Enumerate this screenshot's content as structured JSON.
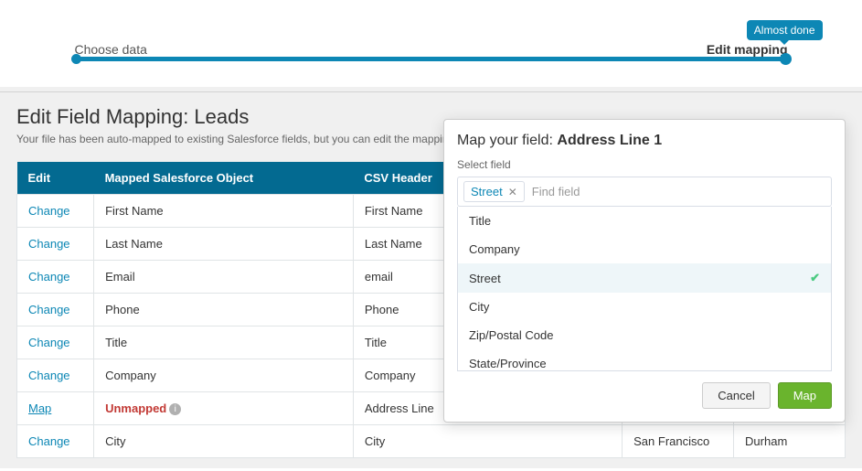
{
  "progress": {
    "badge": "Almost done",
    "step1": "Choose data",
    "step2": "Edit mapping"
  },
  "page": {
    "title": "Edit Field Mapping: Leads",
    "subtitle": "Your file has been auto-mapped to existing Salesforce fields, but you can edit the mappings if you"
  },
  "table": {
    "headers": {
      "edit": "Edit",
      "mapped": "Mapped Salesforce Object",
      "csv": "CSV Header",
      "sample1": "",
      "sample2": ""
    },
    "rows": [
      {
        "edit": "Change",
        "mapped": "First Name",
        "csv": "First Name",
        "s1": "",
        "s2": ""
      },
      {
        "edit": "Change",
        "mapped": "Last Name",
        "csv": "Last Name",
        "s1": "",
        "s2": ""
      },
      {
        "edit": "Change",
        "mapped": "Email",
        "csv": "email",
        "s1": "",
        "s2": ""
      },
      {
        "edit": "Change",
        "mapped": "Phone",
        "csv": "Phone",
        "s1": "",
        "s2": ""
      },
      {
        "edit": "Change",
        "mapped": "Title",
        "csv": "Title",
        "s1": "",
        "s2": ""
      },
      {
        "edit": "Change",
        "mapped": "Company",
        "csv": "Company",
        "s1": "",
        "s2": ""
      },
      {
        "edit": "Map",
        "mapped": "Unmapped",
        "csv": "Address Line",
        "unmapped": true,
        "s1": "",
        "s2": ""
      },
      {
        "edit": "Change",
        "mapped": "City",
        "csv": "City",
        "s1": "San Francisco",
        "s2": "Durham"
      }
    ]
  },
  "modal": {
    "title_prefix": "Map your field: ",
    "title_bold": "Address Line 1",
    "sub": "Select field",
    "chip": "Street",
    "placeholder": "Find field",
    "options": [
      {
        "label": "Title",
        "selected": false
      },
      {
        "label": "Company",
        "selected": false
      },
      {
        "label": "Street",
        "selected": true
      },
      {
        "label": "City",
        "selected": false
      },
      {
        "label": "Zip/Postal Code",
        "selected": false
      },
      {
        "label": "State/Province",
        "selected": false
      }
    ],
    "cancel": "Cancel",
    "map": "Map"
  }
}
